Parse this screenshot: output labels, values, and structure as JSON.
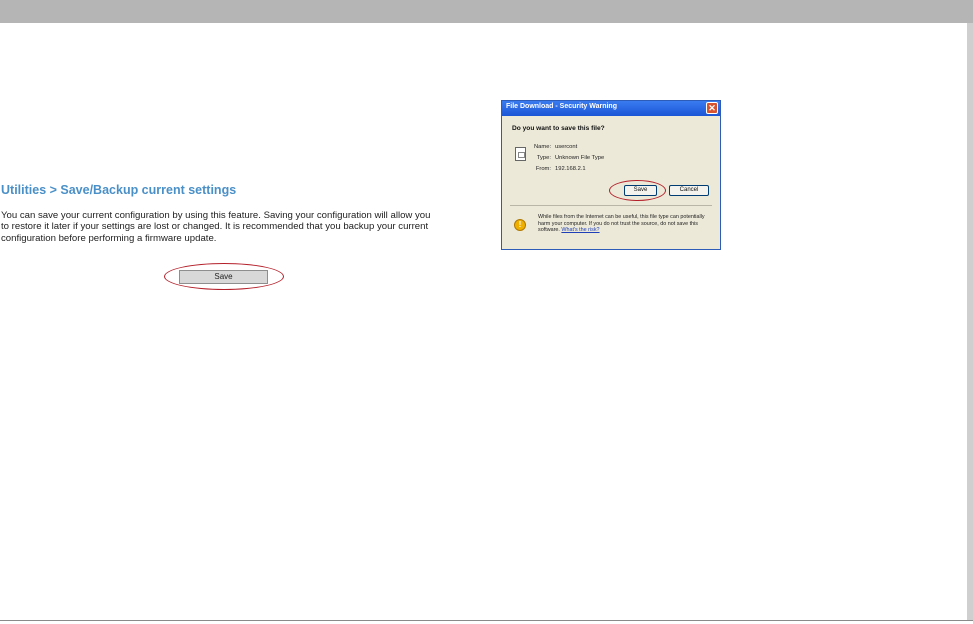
{
  "page": {
    "heading": "Utilities > Save/Backup current settings",
    "description": "You can save your current configuration by using this feature. Saving your configuration will allow you to restore it later if your settings are lost or changed. It is recommended that you backup your current configuration before performing a firmware update.",
    "save_label": "Save",
    "colors": {
      "heading": "#4a90c8",
      "highlight": "#b4202a",
      "top_bar": "#b5b5b5"
    }
  },
  "dialog": {
    "title": "File Download - Security Warning",
    "close_glyph": "✕",
    "question": "Do you want to save this file?",
    "name_label": "Name:",
    "name_value": "usercont",
    "type_label": "Type:",
    "type_value": "Unknown File Type",
    "from_label": "From:",
    "from_value": "192.168.2.1",
    "save_label": "Save",
    "cancel_label": "Cancel",
    "warning_text": "While files from the Internet can be useful, this file type can potentially harm your computer. If you do not trust the source, do not save this software.",
    "warning_link": "What's the risk?",
    "warning_glyph": "!",
    "icons": {
      "file": "file-icon",
      "warning": "shield-warning-icon",
      "close": "close-icon"
    }
  }
}
